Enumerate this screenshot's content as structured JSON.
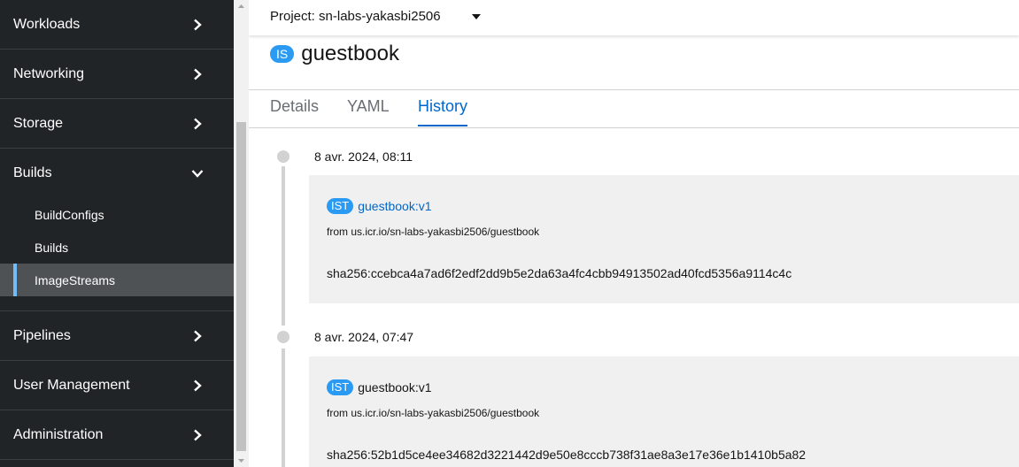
{
  "sidebar": {
    "sections": {
      "workloads": "Workloads",
      "networking": "Networking",
      "storage": "Storage",
      "builds": "Builds",
      "pipelines": "Pipelines",
      "user_management": "User Management",
      "administration": "Administration"
    },
    "builds_items": {
      "buildconfigs": "BuildConfigs",
      "builds": "Builds",
      "imagestreams": "ImageStreams"
    },
    "active_item": "ImageStreams"
  },
  "project": {
    "label": "Project: sn-labs-yakasbi2506"
  },
  "resource": {
    "badge": "IS",
    "name": "guestbook"
  },
  "tabs": {
    "details": "Details",
    "yaml": "YAML",
    "history": "History",
    "active": "History"
  },
  "history": [
    {
      "date": "8 avr. 2024, 08:11",
      "badge": "IST",
      "tag": "guestbook:v1",
      "from": "from us.icr.io/sn-labs-yakasbi2506/guestbook",
      "sha": "sha256:ccebca4a7ad6f2edf2dd9b5e2da63a4fc4cbb94913502ad40fcd5356a9114c4c"
    },
    {
      "date": "8 avr. 2024, 07:47",
      "badge": "IST",
      "tag": "guestbook:v1",
      "from": "from us.icr.io/sn-labs-yakasbi2506/guestbook",
      "sha": "sha256:52b1d5ce4ee34682d3221442d9e50e8cccb738f31ae8a3e17e36e1b1410b5a82"
    }
  ],
  "colors": {
    "sidebar_bg": "#212427",
    "active_accent": "#73bcf7",
    "link": "#0066cc",
    "badge": "#2b9af3"
  },
  "icons": {
    "nav_collapsed": "chevron-right-icon",
    "nav_expanded": "chevron-down-icon",
    "project_dropdown": "caret-down-icon"
  }
}
